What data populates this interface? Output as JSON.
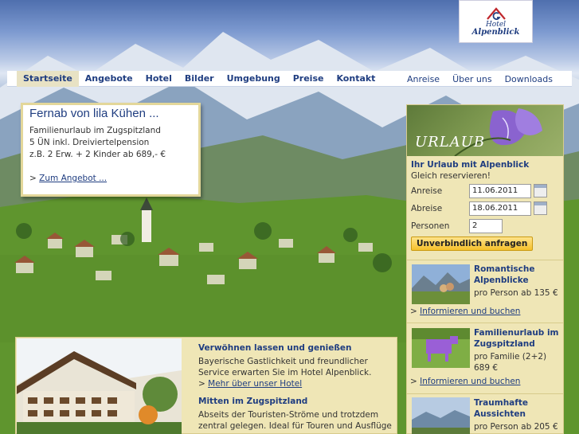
{
  "logo": {
    "line1": "Hotel",
    "line2": "Alpenblick"
  },
  "nav": {
    "main": [
      "Startseite",
      "Angebote",
      "Hotel",
      "Bilder",
      "Umgebung",
      "Preise",
      "Kontakt"
    ],
    "sub": [
      "Anreise",
      "Über uns",
      "Downloads"
    ]
  },
  "offer": {
    "title": "Fernab von lila Kühen ...",
    "line1": "Familienurlaub im Zugspitzland",
    "line2": "5 ÜN inkl. Dreiviertelpension",
    "line3": "z.B. 2 Erw. + 2 Kinder ab 689,- €",
    "link_prefix": ">",
    "link": "Zum Angebot ..."
  },
  "booking": {
    "banner": "URLAUB",
    "heading": "Ihr Urlaub mit Alpenblick",
    "subheading": "Gleich reservieren!",
    "arrival_label": "Anreise",
    "arrival_value": "11.06.2011",
    "departure_label": "Abreise",
    "departure_value": "18.06.2011",
    "persons_label": "Personen",
    "persons_value": "2",
    "button": "Unverbindlich anfragen"
  },
  "promos": [
    {
      "title": "Romantische Alpenblicke",
      "price": "pro Person ab 135 €",
      "link": "Informieren und buchen"
    },
    {
      "title": "Familienurlaub im Zugspitzland",
      "price": "pro Familie (2+2) 689 €",
      "link": "Informieren und buchen"
    },
    {
      "title": "Traumhafte Aussichten",
      "price": "pro Person ab 205 €"
    }
  ],
  "content": {
    "h1": "Verwöhnen lassen und genießen",
    "p1": "Bayerische Gastlichkeit und freundlicher Service erwarten Sie im Hotel Alpenblick.",
    "link1": "Mehr über unser Hotel",
    "h2": "Mitten im Zugspitzland",
    "p2": "Abseits der Touristen-Ströme und trotzdem zentral gelegen. Ideal für Touren und Ausflüge"
  },
  "colors": {
    "brand": "#1f3d80",
    "panel": "#efe6b6",
    "button": "#f5c02a"
  }
}
